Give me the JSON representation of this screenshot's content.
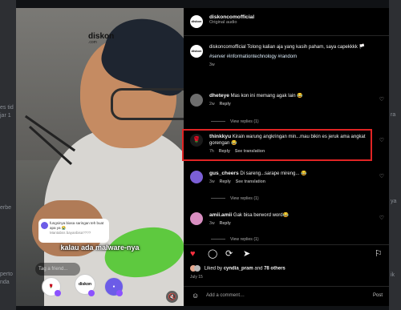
{
  "background": {
    "left_fragments": [
      "es tid",
      "jar 1",
      "erbe",
      "perto",
      "nda"
    ],
    "right_fragments": [
      "ra",
      "ya",
      "ik"
    ]
  },
  "media": {
    "brand": "diskon",
    "brand_sub": ".com",
    "caption": "kalau ada malware-nya",
    "overlay_comment_title": "fungsinya biasa saringan teh buat apa ya 😭",
    "overlay_comment_sub": "Mantabss bayanbisa????",
    "tag_placeholder": "Tag a friend...",
    "live_avatar_label": "diskon",
    "mute_icon": "🔇"
  },
  "post": {
    "username": "diskoncomofficial",
    "audio": "Original audio",
    "caption": "diskoncomofficial Tolong kalian aja yang kasih paham, saya capekkkk 🏳️",
    "hashtags": "#server #informationtechnology #random",
    "caption_age": "3w",
    "avatar_label": "diskon"
  },
  "comments": [
    {
      "username": "dheteye",
      "text": "Mas kon ini memang agak lain 😂",
      "age": "2w",
      "reply": "Reply",
      "view_replies": "View replies (1)",
      "avatar_color": "#6d6d6d"
    },
    {
      "username": "thinkkyu",
      "text": "Kirain warung angkringan min...mau bikin es jeruk ama angkat gorengan 😂",
      "age": "7h",
      "reply": "Reply",
      "see_translation": "See translation",
      "avatar_color": "#1a1a1a"
    },
    {
      "username": "gus_cheers",
      "text": "Di sareng...sarape mireng... 😂",
      "age": "3w",
      "reply": "Reply",
      "see_translation": "See translation",
      "view_replies": "View replies (1)",
      "avatar_color": "#7b5fd6"
    },
    {
      "username": "amii.amii",
      "text": "Gak bisa berword word😂",
      "age": "3w",
      "reply": "Reply",
      "view_replies": "View replies (1)",
      "avatar_color": "#d98ec1"
    }
  ],
  "actions": {
    "liked_by_prefix": "Liked by",
    "liked_by_user": "cyndia_pram",
    "liked_by_and": "and",
    "liked_by_others": "78 others",
    "date": "July 15",
    "add_comment_placeholder": "Add a comment…",
    "post_button": "Post",
    "heart_color": "#ff3040"
  }
}
